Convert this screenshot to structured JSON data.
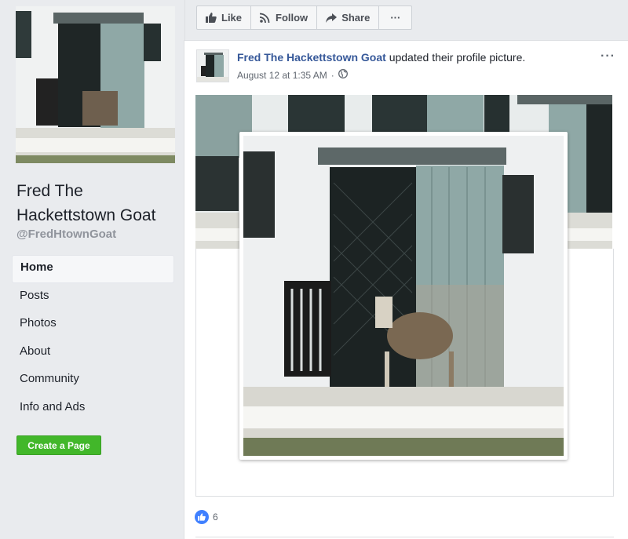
{
  "sidebar": {
    "page_name": "Fred The Hackettstown Goat",
    "handle": "@FredHtownGoat",
    "nav": [
      {
        "label": "Home",
        "active": true
      },
      {
        "label": "Posts",
        "active": false
      },
      {
        "label": "Photos",
        "active": false
      },
      {
        "label": "About",
        "active": false
      },
      {
        "label": "Community",
        "active": false
      },
      {
        "label": "Info and Ads",
        "active": false
      }
    ],
    "create_page_label": "Create a Page"
  },
  "action_bar": {
    "like_label": "Like",
    "follow_label": "Follow",
    "share_label": "Share",
    "more_label": "···"
  },
  "post": {
    "author": "Fred The Hackettstown Goat",
    "action_text": " updated their profile picture.",
    "timestamp": "August 12 at 1:35 AM",
    "separator": "·",
    "menu_label": "···",
    "reaction_count": "6"
  },
  "colors": {
    "link_blue": "#365899",
    "create_green": "#42b72a",
    "like_blue": "#4080ff",
    "background": "#e9ebee"
  }
}
